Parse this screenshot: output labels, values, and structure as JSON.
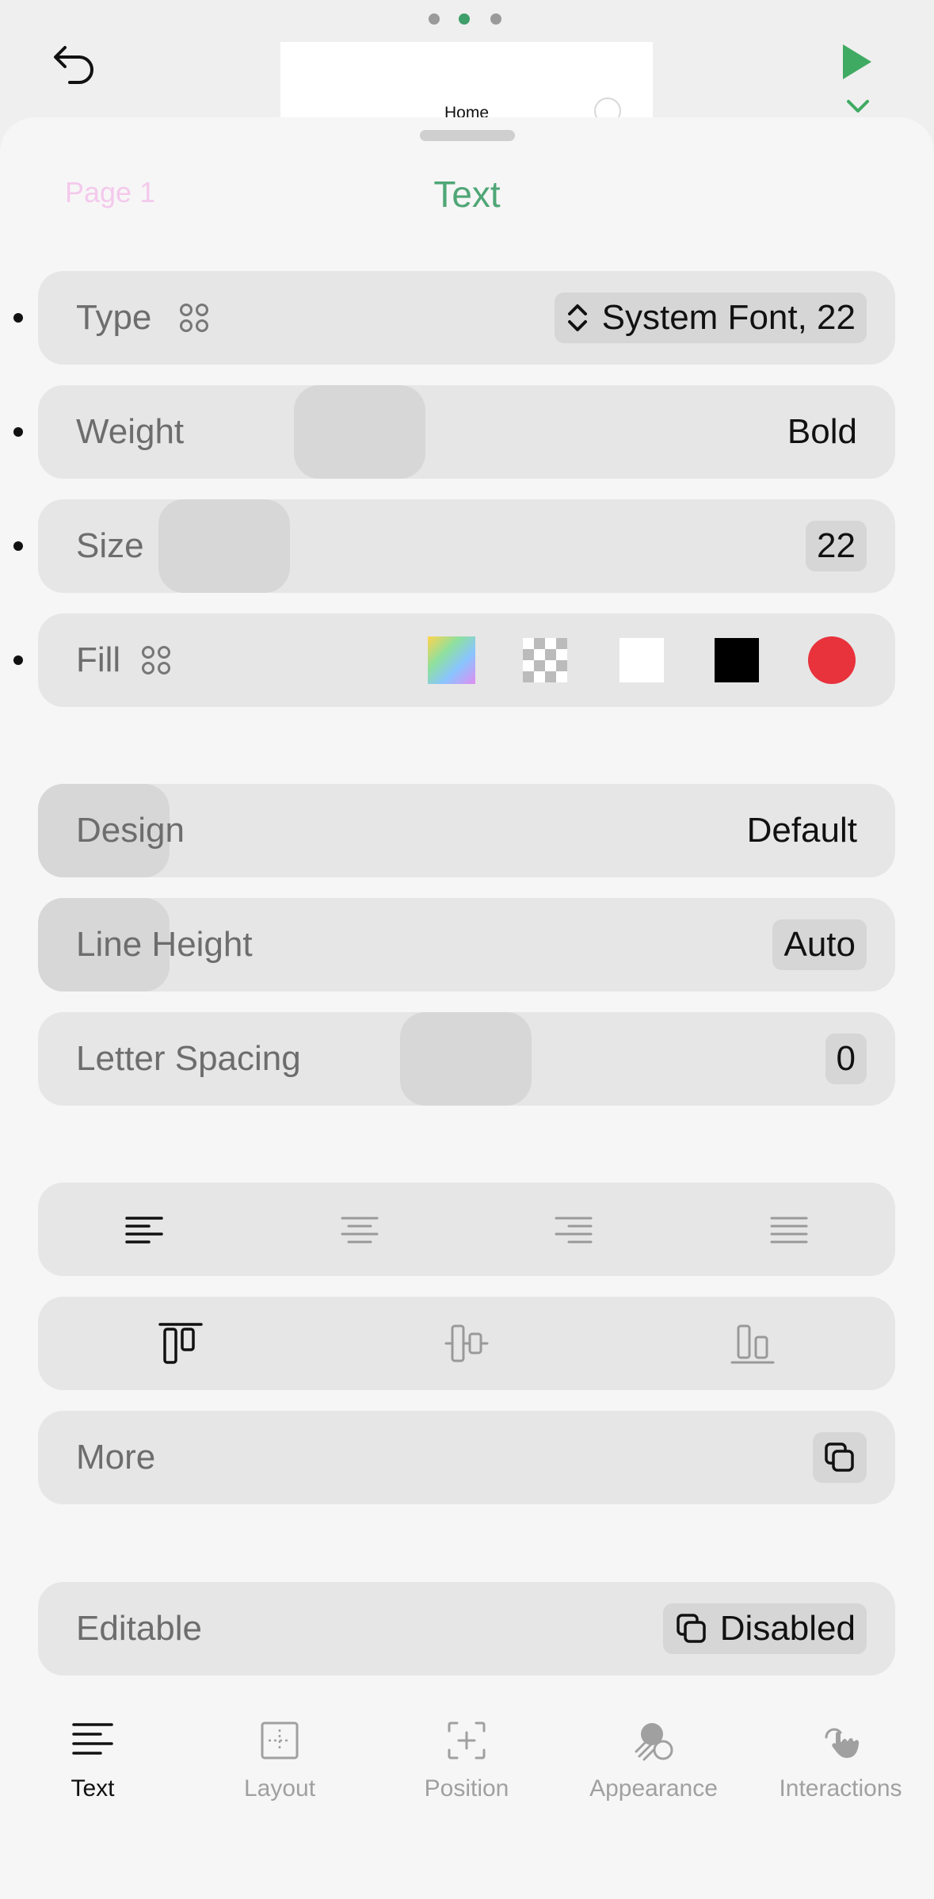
{
  "top": {
    "page_indicator": {
      "count": 3,
      "active_index": 1
    },
    "preview": {
      "home_label": "Home"
    }
  },
  "sheet": {
    "page_label": "Page 1",
    "title": "Text"
  },
  "properties": {
    "type": {
      "label": "Type",
      "value": "System Font, 22"
    },
    "weight": {
      "label": "Weight",
      "value": "Bold"
    },
    "size": {
      "label": "Size",
      "value": "22"
    },
    "fill": {
      "label": "Fill",
      "swatches": [
        "gradient",
        "transparent",
        "#ffffff",
        "#000000",
        "#e8323c"
      ]
    },
    "design": {
      "label": "Design",
      "value": "Default"
    },
    "line_height": {
      "label": "Line Height",
      "value": "Auto"
    },
    "letter_spacing": {
      "label": "Letter Spacing",
      "value": "0"
    },
    "more": {
      "label": "More"
    },
    "editable": {
      "label": "Editable",
      "value": "Disabled"
    }
  },
  "text_alignment": {
    "options": [
      "left",
      "center",
      "right",
      "justify"
    ],
    "selected": "left"
  },
  "vertical_alignment": {
    "options": [
      "top",
      "center",
      "bottom"
    ],
    "selected": "top"
  },
  "tabs": [
    {
      "label": "Text",
      "icon": "text-lines-icon",
      "active": true
    },
    {
      "label": "Layout",
      "icon": "layout-icon",
      "active": false
    },
    {
      "label": "Position",
      "icon": "position-icon",
      "active": false
    },
    {
      "label": "Appearance",
      "icon": "appearance-icon",
      "active": false
    },
    {
      "label": "Interactions",
      "icon": "hand-tap-icon",
      "active": false
    }
  ],
  "colors": {
    "accent": "#4fa676",
    "pink_page": "#f4c9ec",
    "row_bg": "#e6e6e6"
  }
}
